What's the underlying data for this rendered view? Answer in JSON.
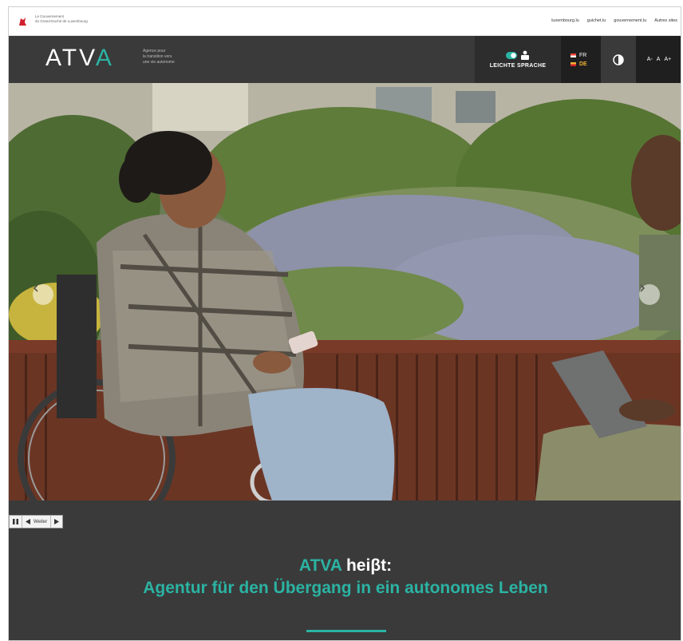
{
  "gov": {
    "text_line1": "Le Gouvernement",
    "text_line2": "du Grand-Duché de Luxembourg",
    "links": [
      "luxembourg.lu",
      "guichet.lu",
      "gouvernement.lu",
      "Autres sites"
    ]
  },
  "header": {
    "logo_text_main": "ATV",
    "logo_text_accent": "A",
    "tagline_line1": "Agence pour",
    "tagline_line2": "la transition vers",
    "tagline_line3": "une vie autonome",
    "easy_language_label": "LEICHTE SPRACHE",
    "languages": [
      {
        "code": "FR",
        "active": false
      },
      {
        "code": "DE",
        "active": true
      }
    ],
    "font_controls": [
      "A-",
      "A",
      "A+"
    ]
  },
  "slider": {
    "prev_icon": "chevron-left-icon",
    "next_icon": "chevron-right-icon",
    "controls": {
      "pause_icon": "pause-icon",
      "back_icon": "triangle-left-icon",
      "label": "Weiter",
      "next_icon": "triangle-right-icon"
    }
  },
  "intro": {
    "title_accent": "ATVA",
    "title_rest": "heiβt:",
    "subtitle": "Agentur für den Übergang in ein autonomes Leben"
  },
  "colors": {
    "accent": "#2bb3a3",
    "header_bg": "#3a3a3a",
    "dark": "#1f1f1f"
  }
}
